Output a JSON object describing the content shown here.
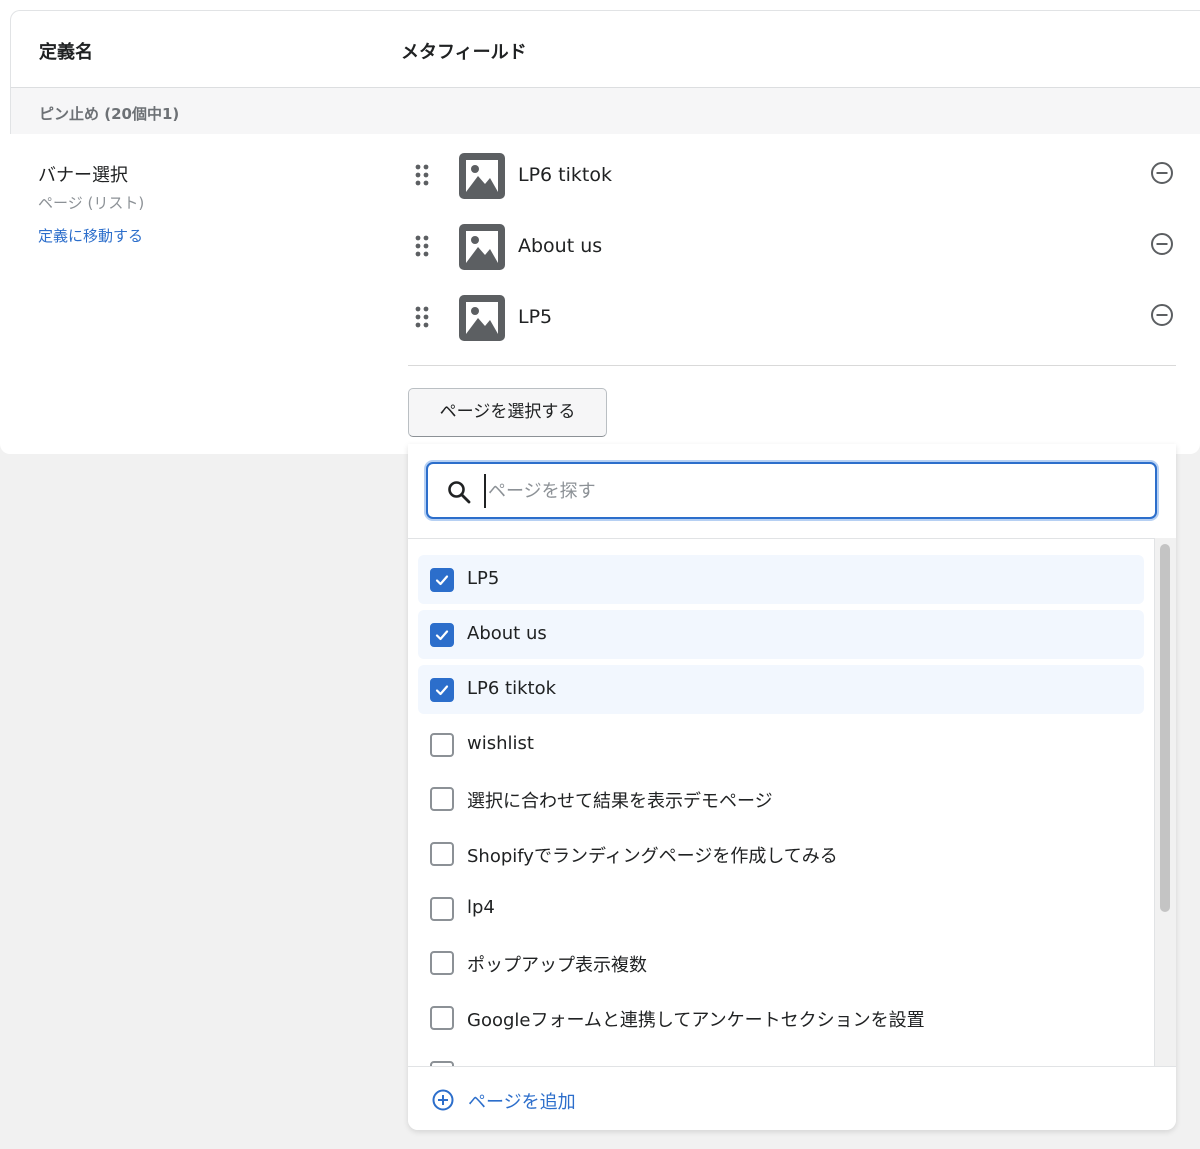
{
  "table_header": {
    "definition_name": "定義名",
    "metafield": "メタフィールド"
  },
  "pinned": {
    "label": "ピン止め (20個中1)"
  },
  "definition": {
    "name": "バナー選択",
    "type": "ページ (リスト)",
    "link": "定義に移動する"
  },
  "selected_items": [
    {
      "label": "LP6 tiktok"
    },
    {
      "label": "About us"
    },
    {
      "label": "LP5"
    }
  ],
  "select_button": "ページを選択する",
  "search": {
    "placeholder": "ページを探す",
    "value": ""
  },
  "options": [
    {
      "label": "LP5",
      "checked": true
    },
    {
      "label": "About us",
      "checked": true
    },
    {
      "label": "LP6 tiktok",
      "checked": true
    },
    {
      "label": "wishlist",
      "checked": false
    },
    {
      "label": "選択に合わせて結果を表示デモページ",
      "checked": false
    },
    {
      "label": "Shopifyでランディングページを作成してみる",
      "checked": false
    },
    {
      "label": "lp4",
      "checked": false
    },
    {
      "label": "ポップアップ表示複数",
      "checked": false
    },
    {
      "label": "Googleフォームと連携してアンケートセクションを設置",
      "checked": false
    }
  ],
  "footer": {
    "add_label": "ページを追加"
  },
  "icons": {
    "drag": "drag-handle-icon",
    "thumb": "image-icon",
    "remove": "remove-circle-icon",
    "search": "search-icon",
    "check": "check-icon",
    "add": "add-circle-icon"
  },
  "colors": {
    "accent": "#2c6ecb",
    "selected_row": "#f2f7fe",
    "thumb": "#5c5f62"
  }
}
